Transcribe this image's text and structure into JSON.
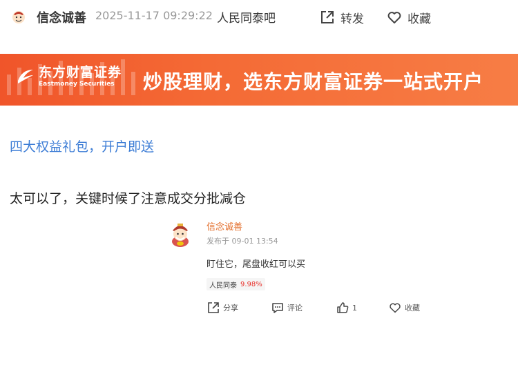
{
  "post": {
    "author": "信念诚善",
    "time": "2025-11-17 09:29:22",
    "bar_name": "人民同泰吧",
    "share_label": "转发",
    "favorite_label": "收藏"
  },
  "banner": {
    "brand_cn": "东方财富证券",
    "brand_en": "Eastmoney Securities",
    "slogan": "炒股理财，选东方财富证券一站式开户",
    "colors": {
      "start": "#f0552a",
      "end": "#f77d45"
    }
  },
  "promo_link": "四大权益礼包，开户即送",
  "content": "太可以了，关键时候了注意成交分批减仓",
  "quote": {
    "author": "信念诚善",
    "time": "发布于 09-01 13:54",
    "text": "盯住它，尾盘收红可以买",
    "stock": {
      "name": "人民同泰",
      "change": "9.98%"
    },
    "actions": {
      "share_label": "分享",
      "comment_label": "评论",
      "like_count": "1",
      "favorite_label": "收藏"
    }
  },
  "icons": [
    "avatar",
    "share-icon",
    "heart-icon",
    "logo-icon",
    "comment-icon",
    "thumbs-up-icon"
  ],
  "accent_colors": {
    "link": "#3a7bd5",
    "author": "#e36d2a",
    "rise": "#e8302a"
  }
}
